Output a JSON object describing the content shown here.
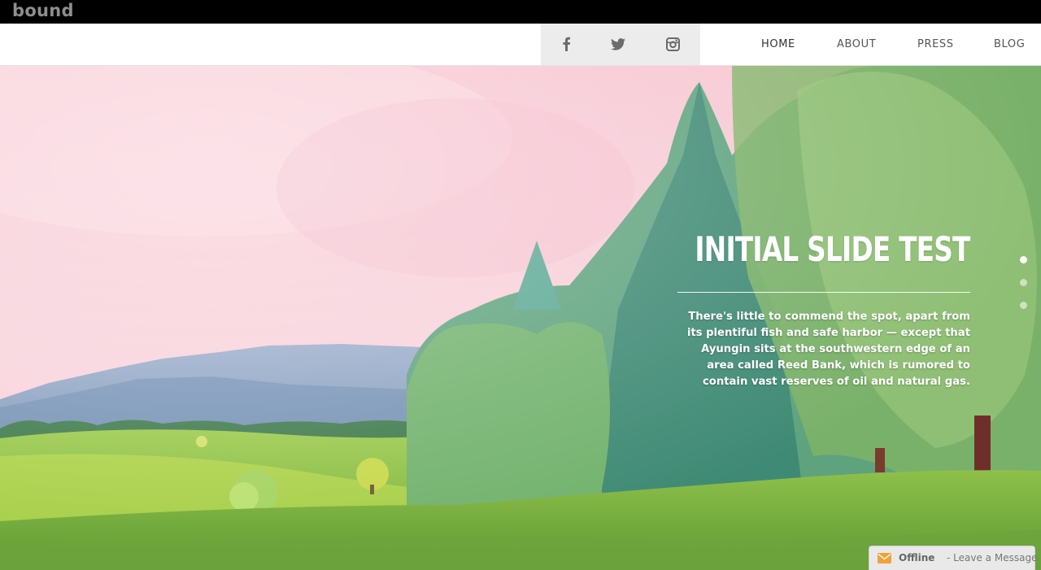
{
  "brand": {
    "name": "bound"
  },
  "social": [
    {
      "name": "facebook-icon"
    },
    {
      "name": "twitter-icon"
    },
    {
      "name": "instagram-icon"
    }
  ],
  "nav": {
    "home": "HOME",
    "about": "ABOUT",
    "press": "PRESS",
    "blog": "BLOG"
  },
  "slide": {
    "title": "INITIAL SLIDE TEST",
    "text": "There's little to commend the spot, apart from its plentiful fish and safe harbor — except that Ayungin sits at the southwestern edge of an area called Reed Bank, which is rumored to contain vast reserves of oil and natural gas.",
    "total_slides": 3,
    "active_slide": 1
  },
  "chat": {
    "status": "Offline",
    "separator": "-",
    "message": "Leave a Message"
  },
  "colors": {
    "sky": "#f6c9d4",
    "grass": "#8fc24a",
    "trees": "#4fa38a",
    "accent": "#f0a23a"
  }
}
